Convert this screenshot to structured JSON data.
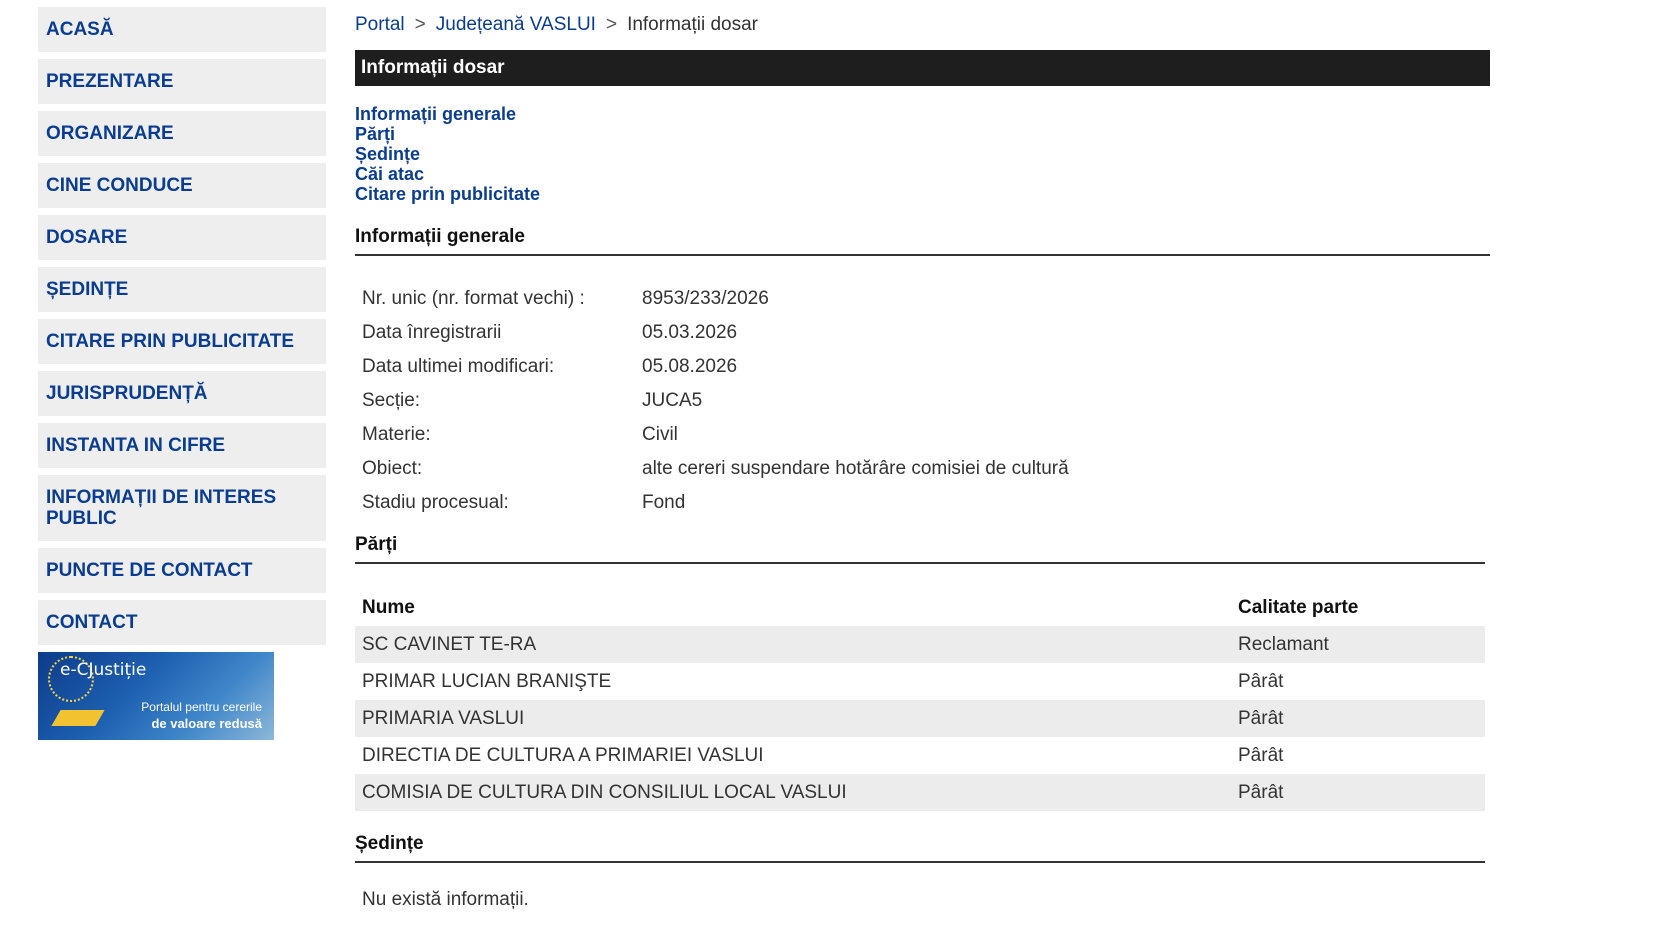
{
  "sidebar": {
    "items": [
      {
        "label": "ACASĂ"
      },
      {
        "label": "PREZENTARE"
      },
      {
        "label": "ORGANIZARE"
      },
      {
        "label": "CINE CONDUCE"
      },
      {
        "label": "DOSARE"
      },
      {
        "label": "ȘEDINȚE"
      },
      {
        "label": "CITARE PRIN PUBLICITATE"
      },
      {
        "label": "JURISPRUDENȚĂ"
      },
      {
        "label": "INSTANTA IN CIFRE"
      },
      {
        "label": "INFORMAȚII DE INTERES PUBLIC"
      },
      {
        "label": "PUNCTE DE CONTACT"
      },
      {
        "label": "CONTACT"
      }
    ],
    "banner": {
      "logo": "e-CJustiție",
      "line1": "Portalul pentru cererile",
      "line2": "de valoare redusă"
    }
  },
  "breadcrumb": {
    "items": [
      "Portal",
      "Județeană VASLUI",
      "Informații dosar"
    ],
    "separator": ">"
  },
  "page_title": "Informații dosar",
  "quick_links": [
    "Informații generale",
    "Părți",
    "Ședințe",
    "Căi atac",
    "Citare prin publicitate"
  ],
  "general": {
    "title": "Informații generale",
    "rows": [
      {
        "label": "Nr. unic (nr. format vechi) :",
        "value": "8953/233/2026"
      },
      {
        "label": "Data înregistrarii",
        "value": "05.03.2026"
      },
      {
        "label": "Data ultimei modificari:",
        "value": "05.08.2026"
      },
      {
        "label": "Secție:",
        "value": "JUCA5"
      },
      {
        "label": "Materie:",
        "value": "Civil"
      },
      {
        "label": "Obiect:",
        "value": "alte cereri suspendare hotărâre comisiei de cultură"
      },
      {
        "label": "Stadiu procesual:",
        "value": "Fond"
      }
    ]
  },
  "parties": {
    "title": "Părți",
    "headers": {
      "name": "Nume",
      "role": "Calitate parte"
    },
    "rows": [
      {
        "name": "SC CAVINET TE-RA",
        "role": "Reclamant"
      },
      {
        "name": "PRIMAR LUCIAN BRANIŞTE",
        "role": "Pârât"
      },
      {
        "name": "PRIMARIA VASLUI",
        "role": "Pârât"
      },
      {
        "name": "DIRECTIA DE CULTURA A PRIMARIEI VASLUI",
        "role": "Pârât"
      },
      {
        "name": "COMISIA DE CULTURA DIN CONSILIUL LOCAL VASLUI",
        "role": "Pârât"
      }
    ]
  },
  "hearings": {
    "title": "Ședințe",
    "empty_text": "Nu există informații."
  },
  "colors": {
    "link": "#0a3d8f",
    "title_bar": "#1e1e1e",
    "nav_bg": "#eeeeee",
    "row_alt": "#ececec"
  }
}
